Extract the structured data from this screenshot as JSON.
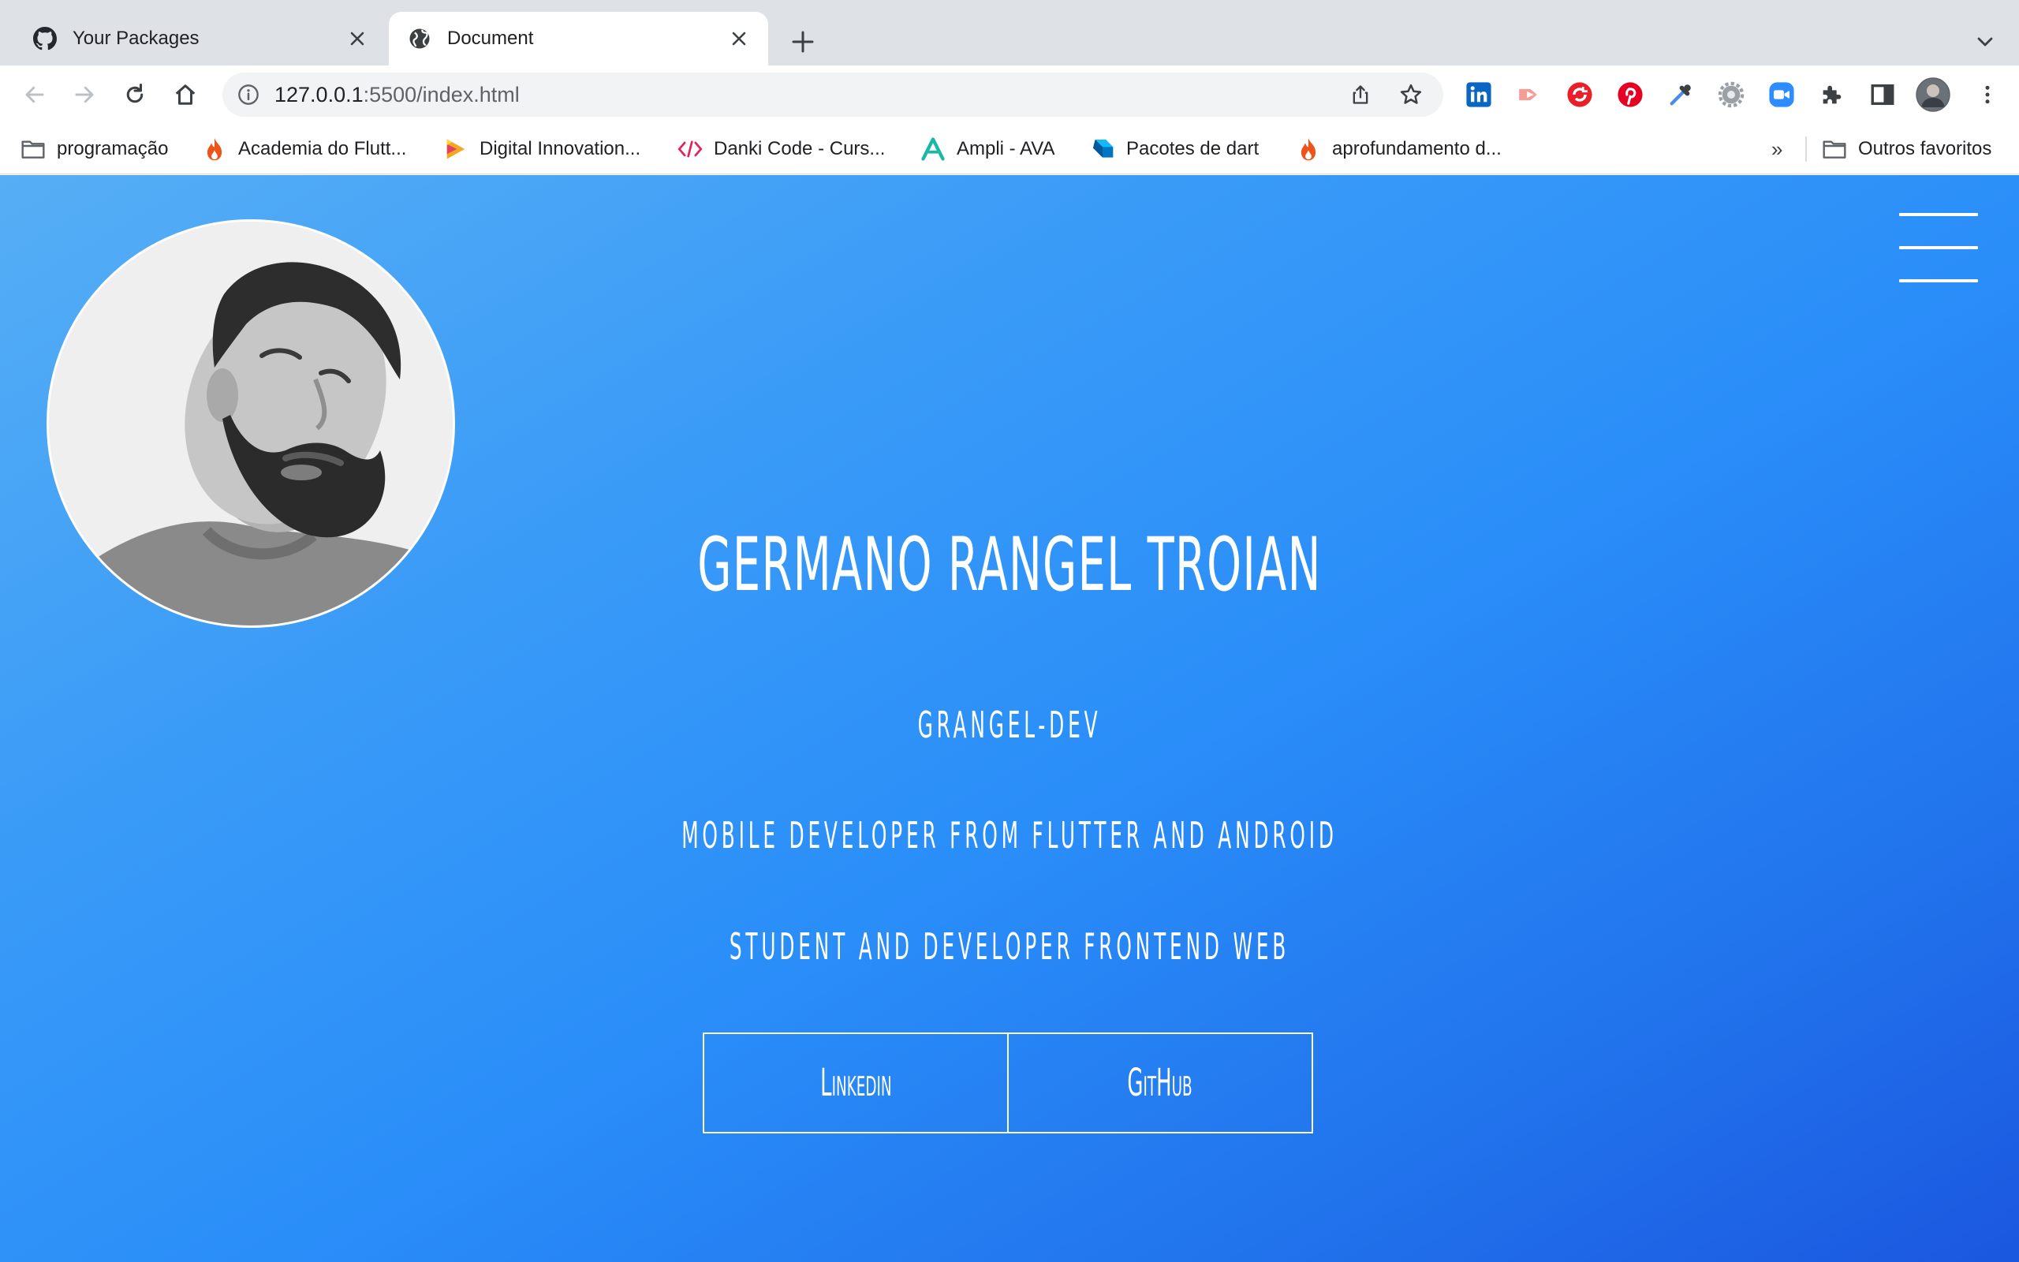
{
  "browser": {
    "tabs": [
      {
        "title": "Your Packages",
        "icon": "github-icon",
        "active": false
      },
      {
        "title": "Document",
        "icon": "globe-icon",
        "active": true
      }
    ],
    "address_bar": {
      "host": "127.0.0.1",
      "path": ":5500/index.html"
    },
    "extensions": [
      "linkedin-icon",
      "screencast-icon",
      "sync-icon",
      "pinterest-icon",
      "eyedropper-icon",
      "gear-icon",
      "zoom-icon",
      "puzzle-icon",
      "side-panel-icon",
      "profile-avatar",
      "menu-dots-icon"
    ],
    "bookmarks": [
      {
        "label": "programação",
        "icon": "folder-icon"
      },
      {
        "label": "Academia do Flutt...",
        "icon": "flame-icon"
      },
      {
        "label": "Digital Innovation...",
        "icon": "dio-icon"
      },
      {
        "label": "Danki Code - Curs...",
        "icon": "code-icon"
      },
      {
        "label": "Ampli - AVA",
        "icon": "ampli-icon"
      },
      {
        "label": "Pacotes de dart",
        "icon": "dart-icon"
      },
      {
        "label": "aprofundamento d...",
        "icon": "flame-icon"
      }
    ],
    "bookmarks_overflow": "»",
    "other_bookmarks": "Outros favoritos"
  },
  "page": {
    "name": "Germano Rangel Troian",
    "handle": "grangel-dev",
    "role": "Mobile developer from Flutter and Android",
    "study": "Student and developer frontend web",
    "buttons": {
      "linkedin": "Linkedin",
      "github": "GitHub"
    },
    "colors": {
      "gradient_start": "#56aef5",
      "gradient_end": "#1b57e0",
      "text": "#ffffff"
    }
  }
}
